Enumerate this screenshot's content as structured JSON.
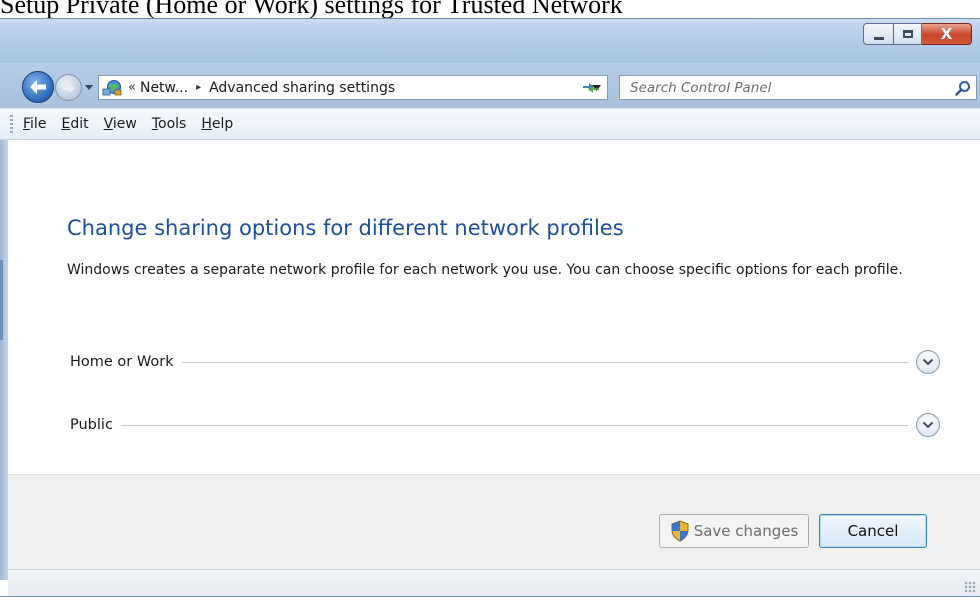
{
  "caption": "Setup Private (Home or Work) settings for Trusted Network",
  "window": {
    "controls": {
      "minimize": "minimize",
      "maximize": "maximize",
      "close": "X"
    }
  },
  "address_bar": {
    "overflow_chevron": "«",
    "crumbs": [
      "Netw...",
      "Advanced sharing settings"
    ],
    "separator": "▸",
    "icon": "network-and-sharing-icon"
  },
  "search": {
    "placeholder": "Search Control Panel",
    "value": ""
  },
  "menu": {
    "items": [
      {
        "key": "F",
        "rest": "ile"
      },
      {
        "key": "E",
        "rest": "dit"
      },
      {
        "key": "V",
        "rest": "iew"
      },
      {
        "key": "T",
        "rest": "ools"
      },
      {
        "key": "H",
        "rest": "elp"
      }
    ]
  },
  "content": {
    "heading": "Change sharing options for different network profiles",
    "description": "Windows creates a separate network profile for each network you use. You can choose specific options for each profile.",
    "profiles": [
      {
        "label": "Home or Work"
      },
      {
        "label": "Public"
      }
    ]
  },
  "footer": {
    "save_label": "Save changes",
    "cancel_label": "Cancel"
  },
  "colors": {
    "heading": "#1e4fa0",
    "frame": "#b6cde6",
    "close_button": "#c7442a"
  }
}
